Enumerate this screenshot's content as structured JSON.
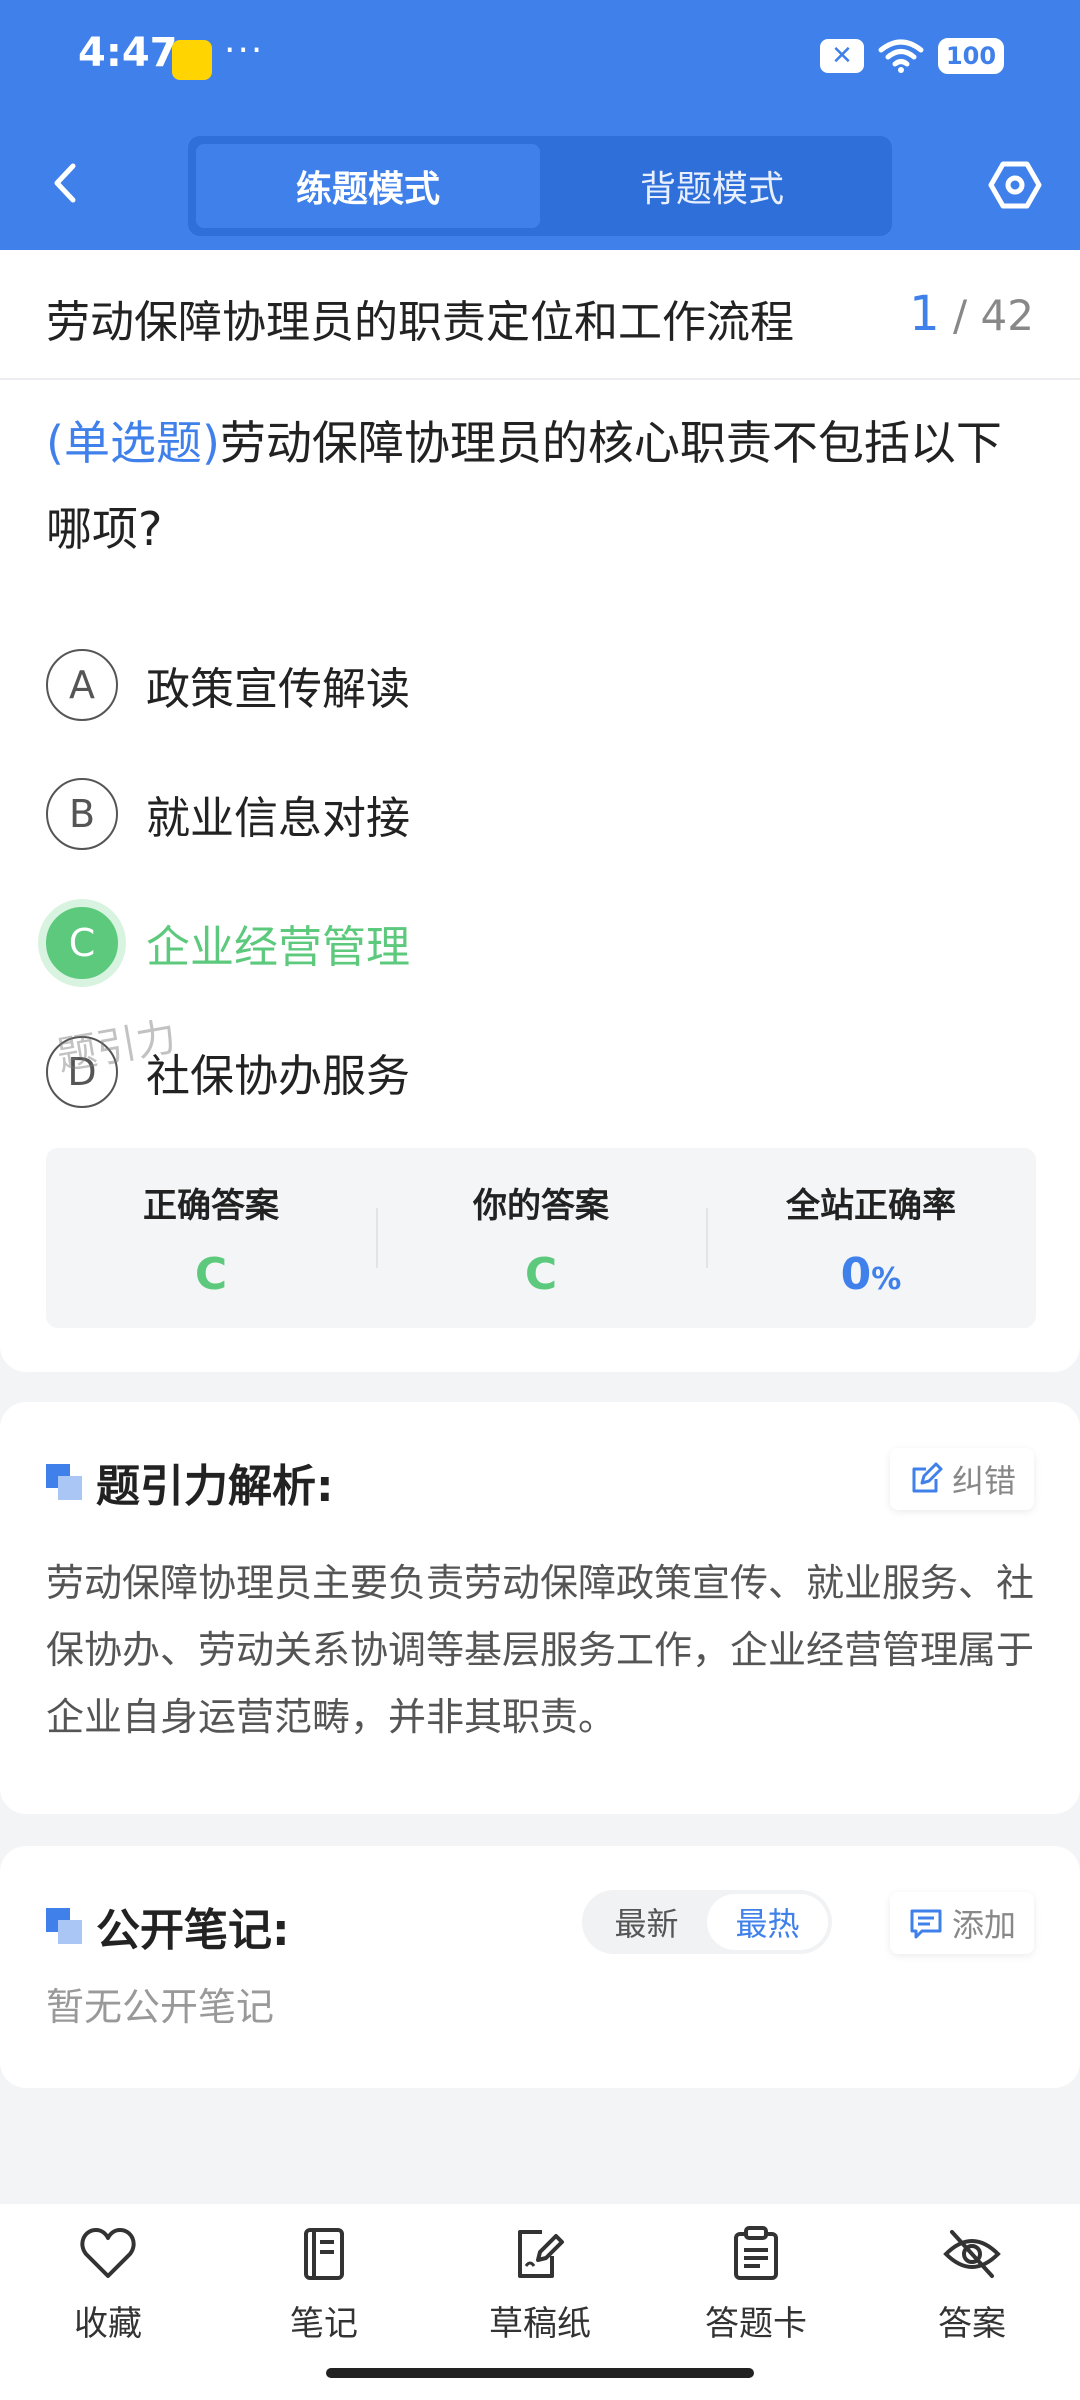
{
  "status": {
    "time": "4:47",
    "dots": "···",
    "battery": "100"
  },
  "nav": {
    "mode_practice": "练题模式",
    "mode_recite": "背题模式"
  },
  "section": {
    "title": "劳动保障协理员的职责定位和工作流程",
    "current": "1",
    "total": "/ 42"
  },
  "question": {
    "type": "(单选题)",
    "text": "劳动保障协理员的核心职责不包括以下哪项?",
    "options": [
      {
        "letter": "A",
        "text": "政策宣传解读"
      },
      {
        "letter": "B",
        "text": "就业信息对接"
      },
      {
        "letter": "C",
        "text": "企业经营管理"
      },
      {
        "letter": "D",
        "text": "社保协办服务"
      }
    ],
    "selected": "C"
  },
  "stats": {
    "correct_label": "正确答案",
    "correct_value": "C",
    "yours_label": "你的答案",
    "yours_value": "C",
    "rate_label": "全站正确率",
    "rate_value": "0",
    "rate_unit": "%"
  },
  "watermark": "题引力",
  "analysis": {
    "title": "题引力解析:",
    "report_label": "纠错",
    "text": "劳动保障协理员主要负责劳动保障政策宣传、就业服务、社保协办、劳动关系协调等基层服务工作，企业经营管理属于企业自身运营范畴，并非其职责。"
  },
  "notes": {
    "title": "公开笔记:",
    "sort_latest": "最新",
    "sort_hot": "最热",
    "add_label": "添加",
    "empty": "暂无公开笔记"
  },
  "bottom_bar": [
    {
      "label": "收藏",
      "icon": "heart-icon"
    },
    {
      "label": "笔记",
      "icon": "notebook-icon"
    },
    {
      "label": "草稿纸",
      "icon": "draft-icon"
    },
    {
      "label": "答题卡",
      "icon": "clipboard-icon"
    },
    {
      "label": "答案",
      "icon": "eye-off-icon"
    }
  ],
  "colors": {
    "primary": "#3f80ea",
    "correct": "#5cc97d",
    "background": "#f3f4f6"
  }
}
